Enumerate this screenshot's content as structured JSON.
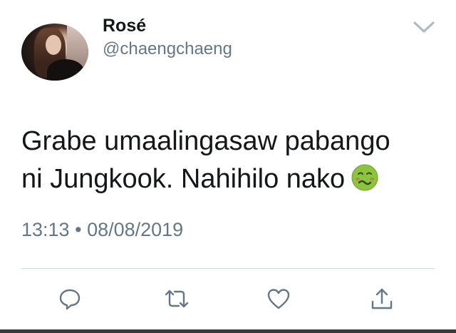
{
  "tweet": {
    "display_name": "Rosé",
    "handle": "@chaengchaeng",
    "text_line1": "Grabe umaalingasaw pabango",
    "text_line2": "ni Jungkook. Nahihilo nako",
    "emoji": "nauseated-face",
    "time": "13:13",
    "separator": "•",
    "date": "08/08/2019"
  },
  "icons": {
    "caret": "chevron-down-icon",
    "reply": "reply-icon",
    "retweet": "retweet-icon",
    "like": "heart-icon",
    "share": "share-icon"
  },
  "colors": {
    "text": "#14171a",
    "secondary": "#657786",
    "divider": "#ccd6dd",
    "icon": "#657786"
  }
}
